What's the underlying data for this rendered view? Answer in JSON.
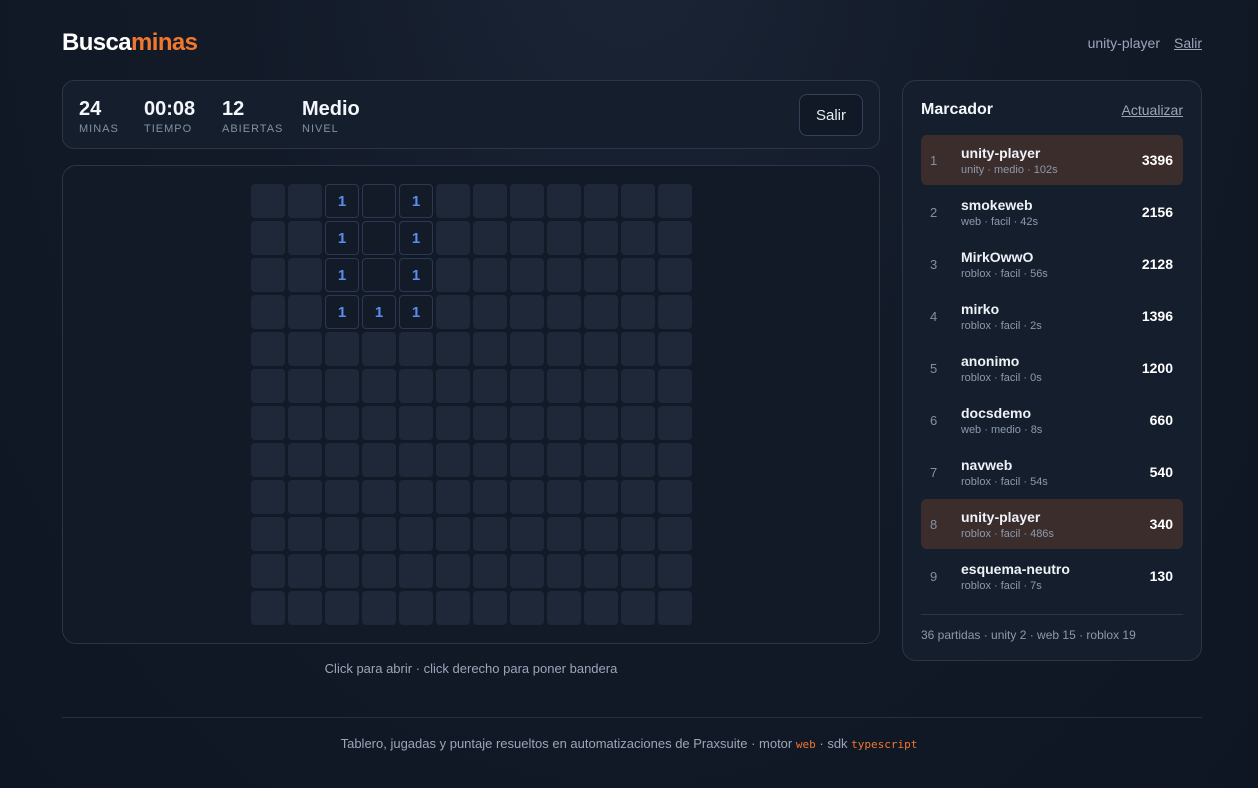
{
  "logo": {
    "part1": "Busca",
    "part2": "minas"
  },
  "user": {
    "name": "unity-player",
    "logout_label": "Salir"
  },
  "stats": [
    {
      "value": "24",
      "label": "Minas"
    },
    {
      "value": "00:08",
      "label": "Tiempo"
    },
    {
      "value": "12",
      "label": "Abiertas"
    },
    {
      "value": "Medio",
      "label": "Nivel"
    }
  ],
  "exit_label": "Salir",
  "board": {
    "rows": 12,
    "cols": 12,
    "open_cells": [
      {
        "row": 0,
        "col": 2,
        "value": "1"
      },
      {
        "row": 0,
        "col": 3,
        "value": ""
      },
      {
        "row": 0,
        "col": 4,
        "value": "1"
      },
      {
        "row": 1,
        "col": 2,
        "value": "1"
      },
      {
        "row": 1,
        "col": 3,
        "value": ""
      },
      {
        "row": 1,
        "col": 4,
        "value": "1"
      },
      {
        "row": 2,
        "col": 2,
        "value": "1"
      },
      {
        "row": 2,
        "col": 3,
        "value": ""
      },
      {
        "row": 2,
        "col": 4,
        "value": "1"
      },
      {
        "row": 3,
        "col": 2,
        "value": "1"
      },
      {
        "row": 3,
        "col": 3,
        "value": "1"
      },
      {
        "row": 3,
        "col": 4,
        "value": "1"
      }
    ]
  },
  "hint": "Click para abrir · click derecho para poner bandera",
  "scoreboard": {
    "title": "Marcador",
    "refresh_label": "Actualizar",
    "entries": [
      {
        "rank": "1",
        "name": "unity-player",
        "meta": "unity · medio · 102s",
        "score": "3396",
        "highlight": true
      },
      {
        "rank": "2",
        "name": "smokeweb",
        "meta": "web · facil · 42s",
        "score": "2156",
        "highlight": false
      },
      {
        "rank": "3",
        "name": "MirkOwwO",
        "meta": "roblox · facil · 56s",
        "score": "2128",
        "highlight": false
      },
      {
        "rank": "4",
        "name": "mirko",
        "meta": "roblox · facil · 2s",
        "score": "1396",
        "highlight": false
      },
      {
        "rank": "5",
        "name": "anonimo",
        "meta": "roblox · facil · 0s",
        "score": "1200",
        "highlight": false
      },
      {
        "rank": "6",
        "name": "docsdemo",
        "meta": "web · medio · 8s",
        "score": "660",
        "highlight": false
      },
      {
        "rank": "7",
        "name": "navweb",
        "meta": "roblox · facil · 54s",
        "score": "540",
        "highlight": false
      },
      {
        "rank": "8",
        "name": "unity-player",
        "meta": "roblox · facil · 486s",
        "score": "340",
        "highlight": true
      },
      {
        "rank": "9",
        "name": "esquema-neutro",
        "meta": "roblox · facil · 7s",
        "score": "130",
        "highlight": false
      }
    ],
    "footer": "36 partidas · unity 2 · web 15 · roblox 19"
  },
  "footer": {
    "text": "Tablero, jugadas y puntaje resueltos en automatizaciones de Praxsuite · motor",
    "engine": "web",
    "sdk_label": "· sdk",
    "sdk": "typescript"
  },
  "colors": {
    "accent": "#f0772e",
    "number_one": "#5b8dee",
    "highlight_row": "#3b2d2b"
  }
}
